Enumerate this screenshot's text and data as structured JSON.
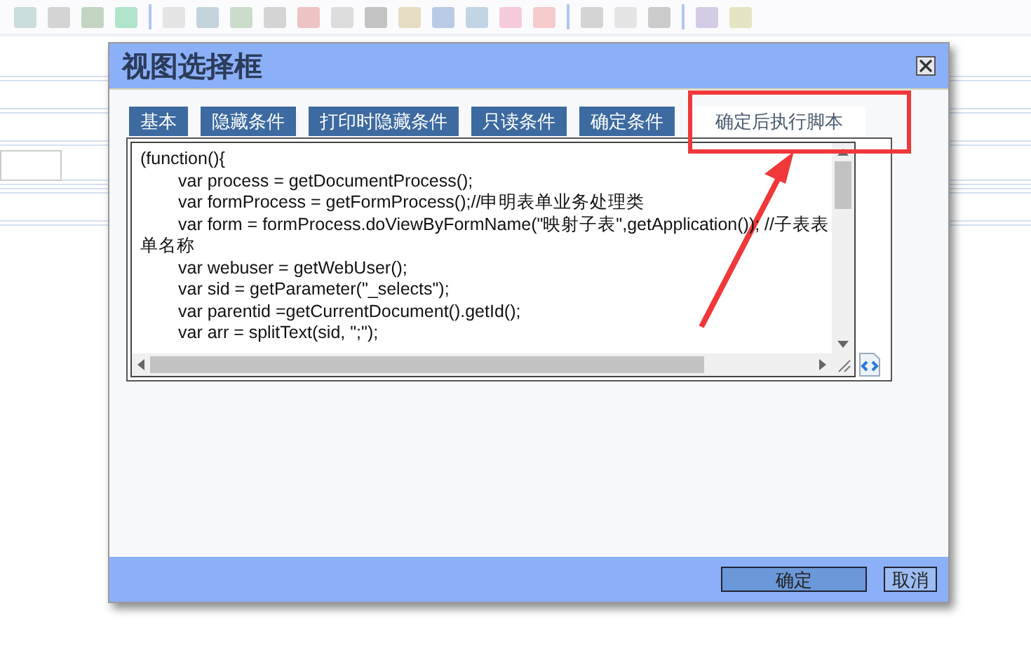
{
  "dialog": {
    "title": "视图选择框",
    "tabs": [
      {
        "label": "基本",
        "selected": false
      },
      {
        "label": "隐藏条件",
        "selected": false
      },
      {
        "label": "打印时隐藏条件",
        "selected": false
      },
      {
        "label": "只读条件",
        "selected": false
      },
      {
        "label": "确定条件",
        "selected": false
      },
      {
        "label": "确定后执行脚本",
        "selected": true
      }
    ],
    "script_lines": [
      {
        "text": "(function(){",
        "indented": false
      },
      {
        "text": "var process = getDocumentProcess();",
        "indented": true
      },
      {
        "text": "var formProcess = getFormProcess();//申明表单业务处理类",
        "indented": true
      },
      {
        "text": "var form = formProcess.doViewByFormName(\"映射子表\",getApplication()); //子表表",
        "indented": true
      },
      {
        "text": "单名称",
        "indented": false
      },
      {
        "text": "var webuser = getWebUser();",
        "indented": true
      },
      {
        "text": "var sid = getParameter(\"_selects\");",
        "indented": true
      },
      {
        "text": "var parentid =getCurrentDocument().getId();",
        "indented": true
      },
      {
        "text": "var arr = splitText(sid, \";\");",
        "indented": true
      }
    ],
    "buttons": [
      {
        "label": "确定",
        "kind": "primary"
      },
      {
        "label": "取消",
        "kind": "secondary"
      }
    ]
  }
}
